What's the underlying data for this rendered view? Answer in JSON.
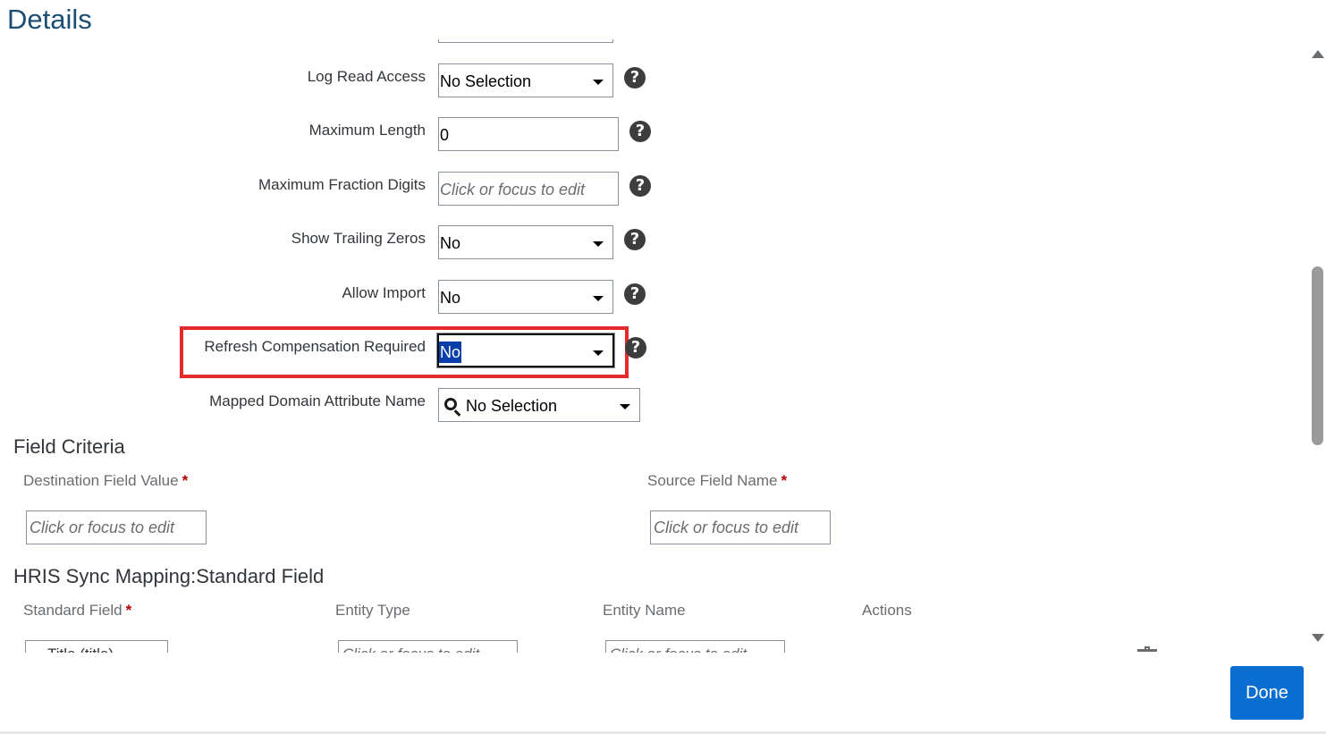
{
  "header": {
    "title": "Details"
  },
  "form": {
    "log_read_access": {
      "label": "Log Read Access",
      "value": "No Selection"
    },
    "maximum_length": {
      "label": "Maximum Length",
      "value": "0"
    },
    "maximum_fraction_digits": {
      "label": "Maximum Fraction Digits",
      "placeholder": "Click or focus to edit"
    },
    "show_trailing_zeros": {
      "label": "Show Trailing Zeros",
      "value": "No"
    },
    "allow_import": {
      "label": "Allow Import",
      "value": "No"
    },
    "refresh_compensation_required": {
      "label": "Refresh Compensation Required",
      "value": "No"
    },
    "mapped_domain_attribute_name": {
      "label": "Mapped Domain Attribute Name",
      "value": "No Selection"
    },
    "help_glyph": "?"
  },
  "field_criteria": {
    "title": "Field Criteria",
    "destination_label": "Destination Field Value",
    "source_label": "Source Field Name",
    "required_mark": "*",
    "destination_placeholder": "Click or focus to edit",
    "source_placeholder": "Click or focus to edit"
  },
  "hris_sync": {
    "title": "HRIS Sync Mapping:Standard Field",
    "columns": {
      "standard_field": "Standard Field",
      "entity_type": "Entity Type",
      "entity_name": "Entity Name",
      "actions": "Actions"
    },
    "row": {
      "standard_field_value": "Title (title)",
      "entity_type_placeholder": "Click or focus to edit",
      "entity_name_placeholder": "Click or focus to edit"
    }
  },
  "footer": {
    "done_label": "Done"
  },
  "colors": {
    "title": "#1c4e74",
    "primary_button": "#0a6ed1",
    "highlight": "#e32b2b",
    "required": "#bb0000"
  }
}
